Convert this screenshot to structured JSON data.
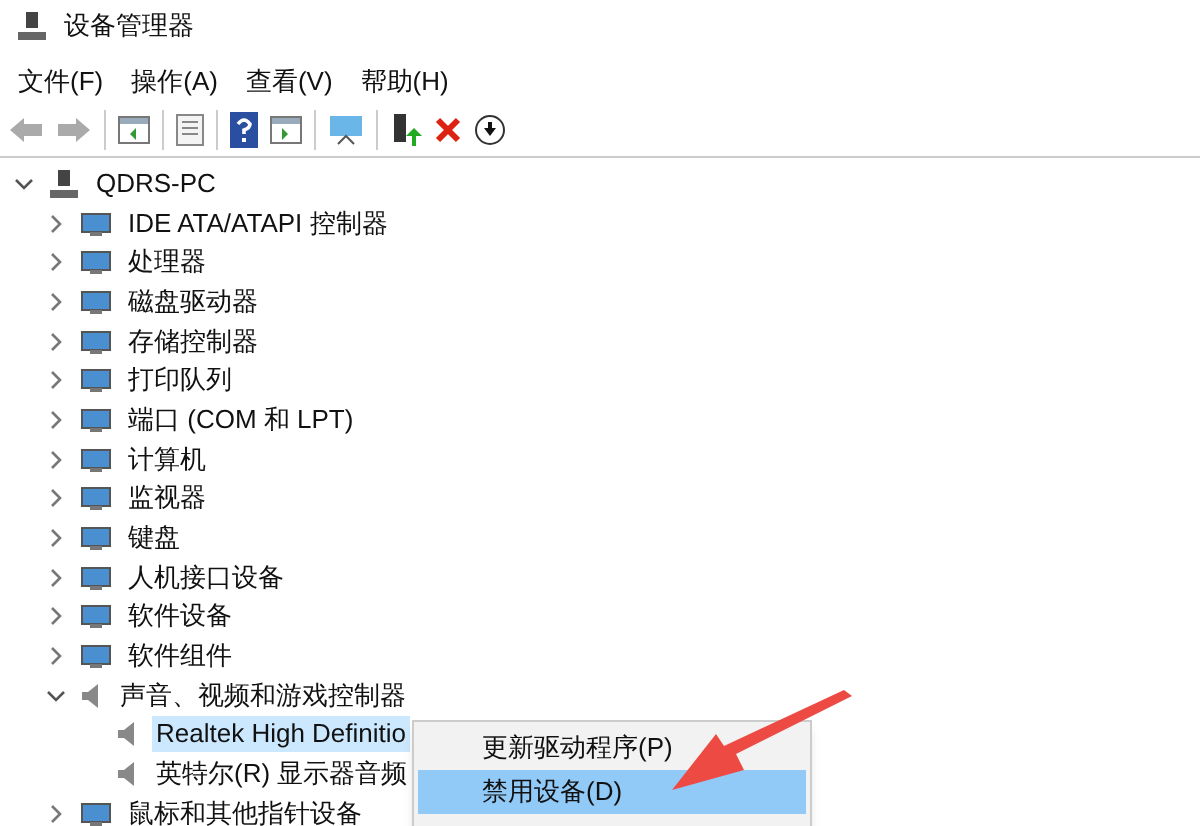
{
  "window": {
    "title": "设备管理器"
  },
  "menu": [
    "文件(F)",
    "操作(A)",
    "查看(V)",
    "帮助(H)"
  ],
  "tree": {
    "label": "QDRS-PC",
    "expanded": true,
    "children": [
      {
        "label": "IDE ATA/ATAPI 控制器",
        "expanded": false
      },
      {
        "label": "处理器",
        "expanded": false
      },
      {
        "label": "磁盘驱动器",
        "expanded": false
      },
      {
        "label": "存储控制器",
        "expanded": false
      },
      {
        "label": "打印队列",
        "expanded": false
      },
      {
        "label": "端口 (COM 和 LPT)",
        "expanded": false
      },
      {
        "label": "计算机",
        "expanded": false
      },
      {
        "label": "监视器",
        "expanded": false
      },
      {
        "label": "键盘",
        "expanded": false
      },
      {
        "label": "人机接口设备",
        "expanded": false
      },
      {
        "label": "软件设备",
        "expanded": false
      },
      {
        "label": "软件组件",
        "expanded": false
      },
      {
        "label": "声音、视频和游戏控制器",
        "expanded": true,
        "children": [
          {
            "label": "Realtek High Definitio",
            "selected": true
          },
          {
            "label": "英特尔(R) 显示器音频",
            "selected": false
          }
        ]
      },
      {
        "label": "鼠标和其他指针设备",
        "expanded": false
      }
    ]
  },
  "context_menu": [
    {
      "label": "更新驱动程序(P)",
      "selected": false
    },
    {
      "label": "禁用设备(D)",
      "selected": true
    }
  ]
}
